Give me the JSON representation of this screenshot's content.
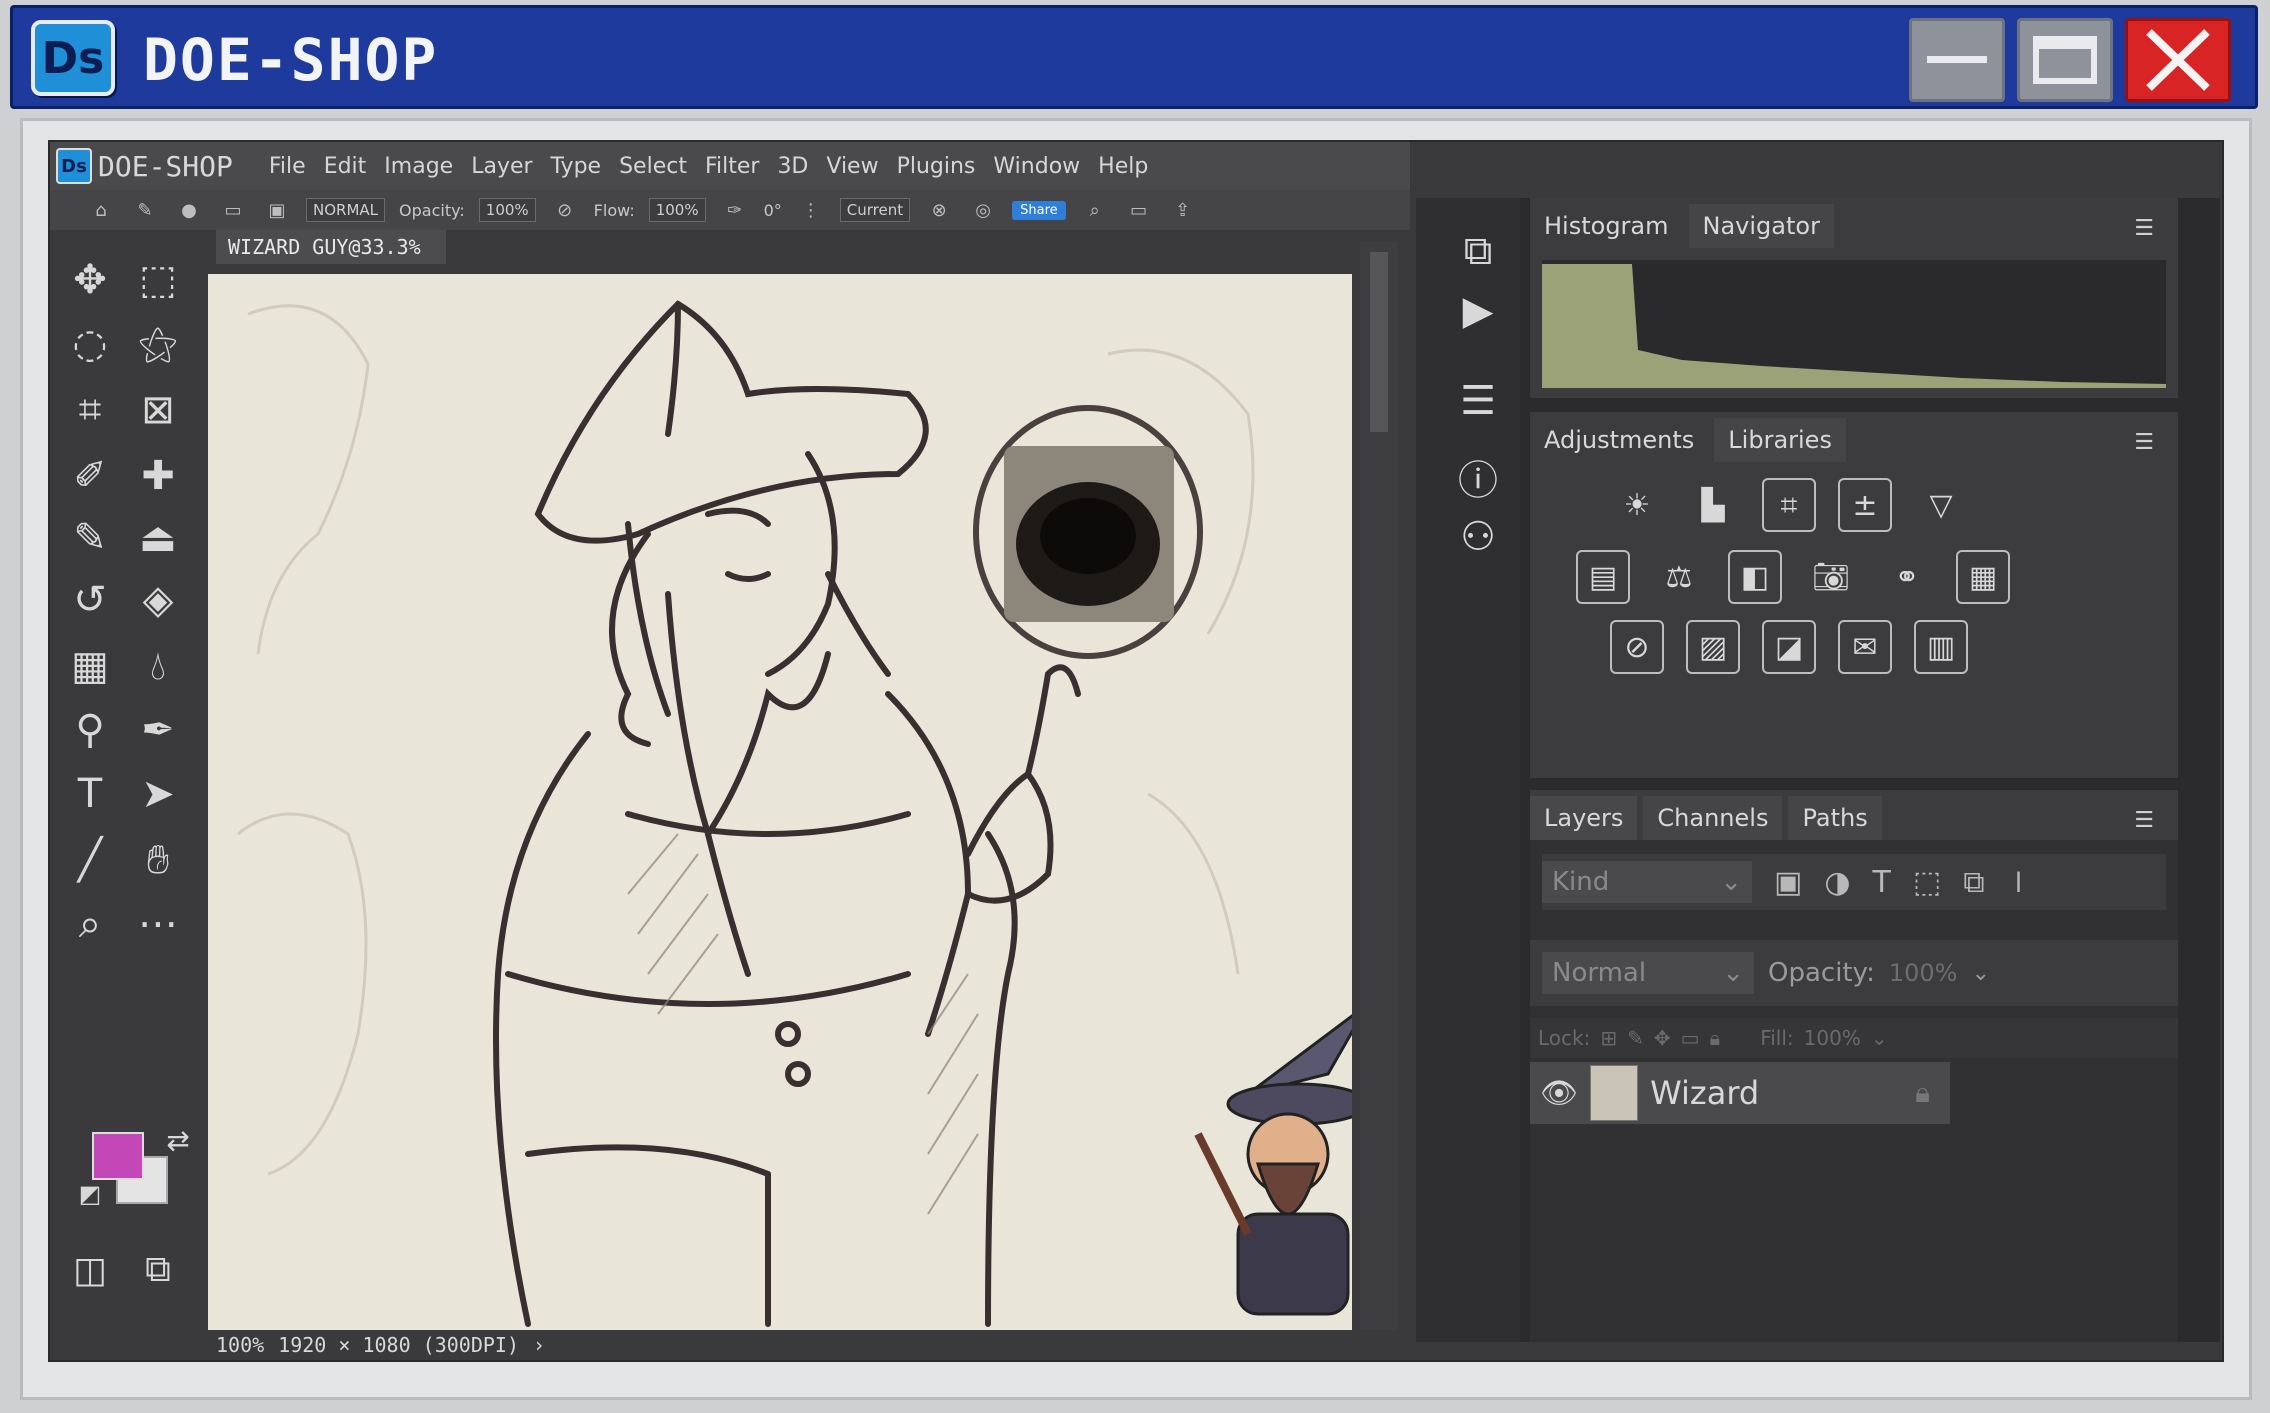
{
  "window": {
    "logo": "Ds",
    "title": "DOE-SHOP",
    "colors": {
      "titlebar": "#1d3a9c",
      "close": "#d82424",
      "minmax": "#8d929b"
    }
  },
  "menubar": {
    "logo": "Ds",
    "title": "DOE-SHOP",
    "items": [
      "File",
      "Edit",
      "Image",
      "Layer",
      "Type",
      "Select",
      "Filter",
      "3D",
      "View",
      "Plugins",
      "Window",
      "Help"
    ]
  },
  "options": {
    "blend_mode": "NORMAL",
    "opacity_label": "Opacity:",
    "opacity_value": "100%",
    "flow_label": "Flow:",
    "flow_value": "100%",
    "angle_value": "0°",
    "sample": "Current",
    "share": "Share"
  },
  "document": {
    "tab_title": "WIZARD GUY@33.3%",
    "zoom": "100%",
    "dimensions": "1920 × 1080 (300DPI)"
  },
  "colors": {
    "foreground": "#c447b8",
    "background": "#e4e4e4",
    "canvas": "#e9e5d8"
  },
  "histogram_panel": {
    "tabs": [
      "Histogram",
      "Navigator"
    ]
  },
  "adjustments_panel": {
    "tabs": [
      "Adjustments",
      "Libraries"
    ]
  },
  "layers_panel": {
    "tabs": [
      "Layers",
      "Channels",
      "Paths"
    ],
    "filter_placeholder": "Kind",
    "blend_mode": "Normal",
    "opacity_label": "Opacity:",
    "opacity_value": "100%",
    "lock_label": "Lock:",
    "fill_label": "Fill:",
    "fill_value": "100%",
    "layers": [
      {
        "name": "Wizard",
        "visible": true,
        "locked": true
      }
    ]
  },
  "icons": {
    "tools": [
      "move-icon",
      "marquee-icon",
      "lasso-icon",
      "magic-wand-icon",
      "crop-icon",
      "frame-icon",
      "eyedropper-icon",
      "healing-brush-icon",
      "brush-icon",
      "stamp-icon",
      "history-brush-icon",
      "eraser-icon",
      "gradient-icon",
      "blur-icon",
      "dodge-icon",
      "pen-icon",
      "type-icon",
      "path-select-icon",
      "line-icon",
      "hand-icon",
      "zoom-icon",
      "more-icon"
    ]
  }
}
